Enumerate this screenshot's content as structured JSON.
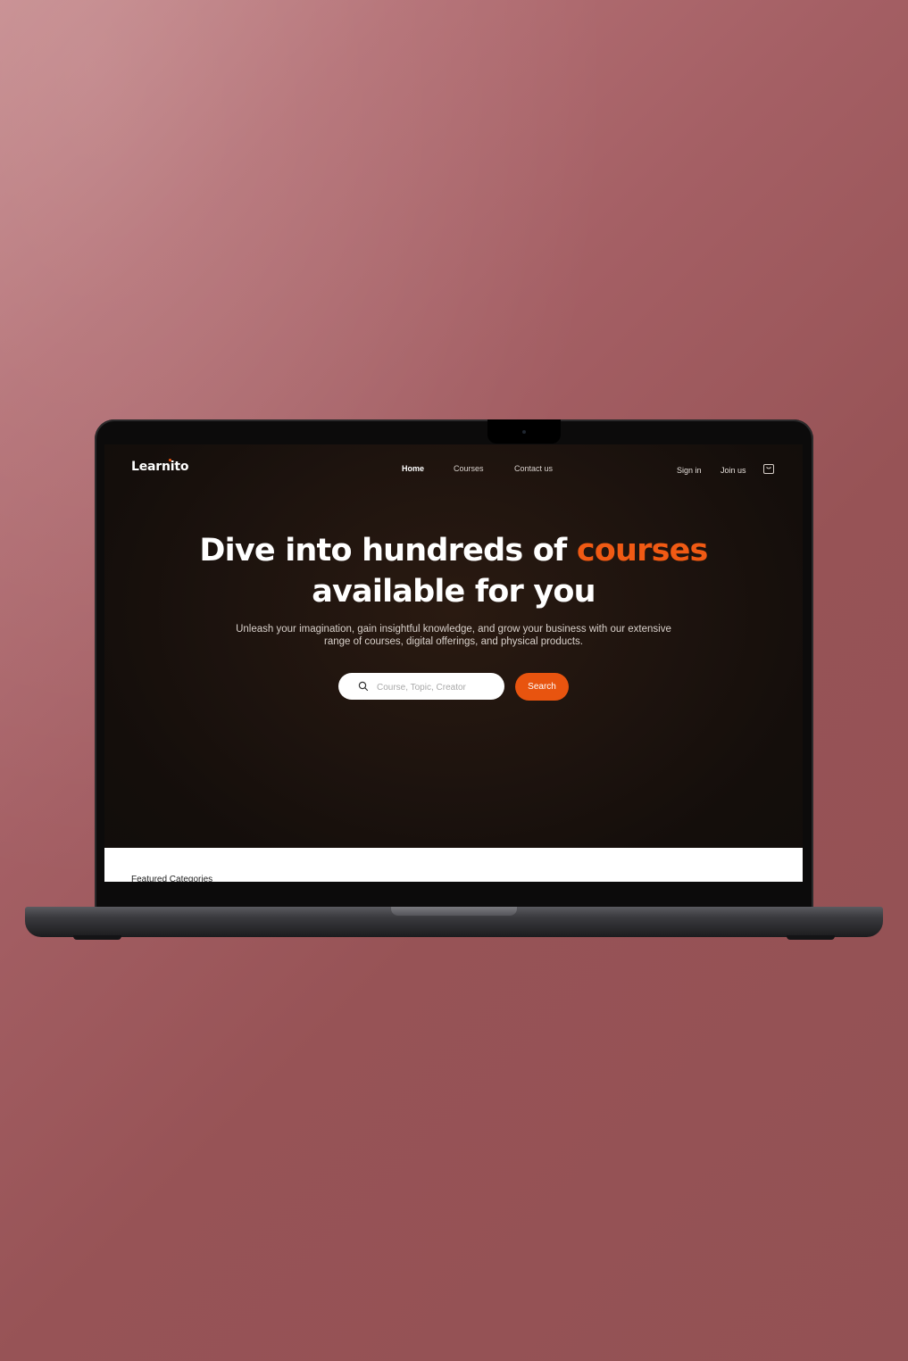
{
  "brand": {
    "name": "Learnito",
    "accent_color": "#f05a14"
  },
  "nav": {
    "items": [
      {
        "label": "Home",
        "active": true
      },
      {
        "label": "Courses",
        "active": false
      },
      {
        "label": "Contact us",
        "active": false
      }
    ]
  },
  "auth": {
    "sign_in": "Sign in",
    "join": "Join us",
    "cart_icon": "shopping-bag-icon"
  },
  "hero": {
    "title_prefix": "Dive into hundreds of ",
    "title_accent": "courses",
    "title_suffix": "available for you",
    "subtitle": "Unleash your imagination, gain insightful knowledge, and grow your business with our extensive range of courses, digital offerings, and physical products."
  },
  "search": {
    "icon": "search-icon",
    "placeholder": "Course, Topic, Creator",
    "button_label": "Search"
  },
  "featured": {
    "title": "Featured Categories"
  },
  "colors": {
    "screen_bg": "#140e0b",
    "accent": "#e8540f",
    "backdrop": "#9a5559"
  }
}
